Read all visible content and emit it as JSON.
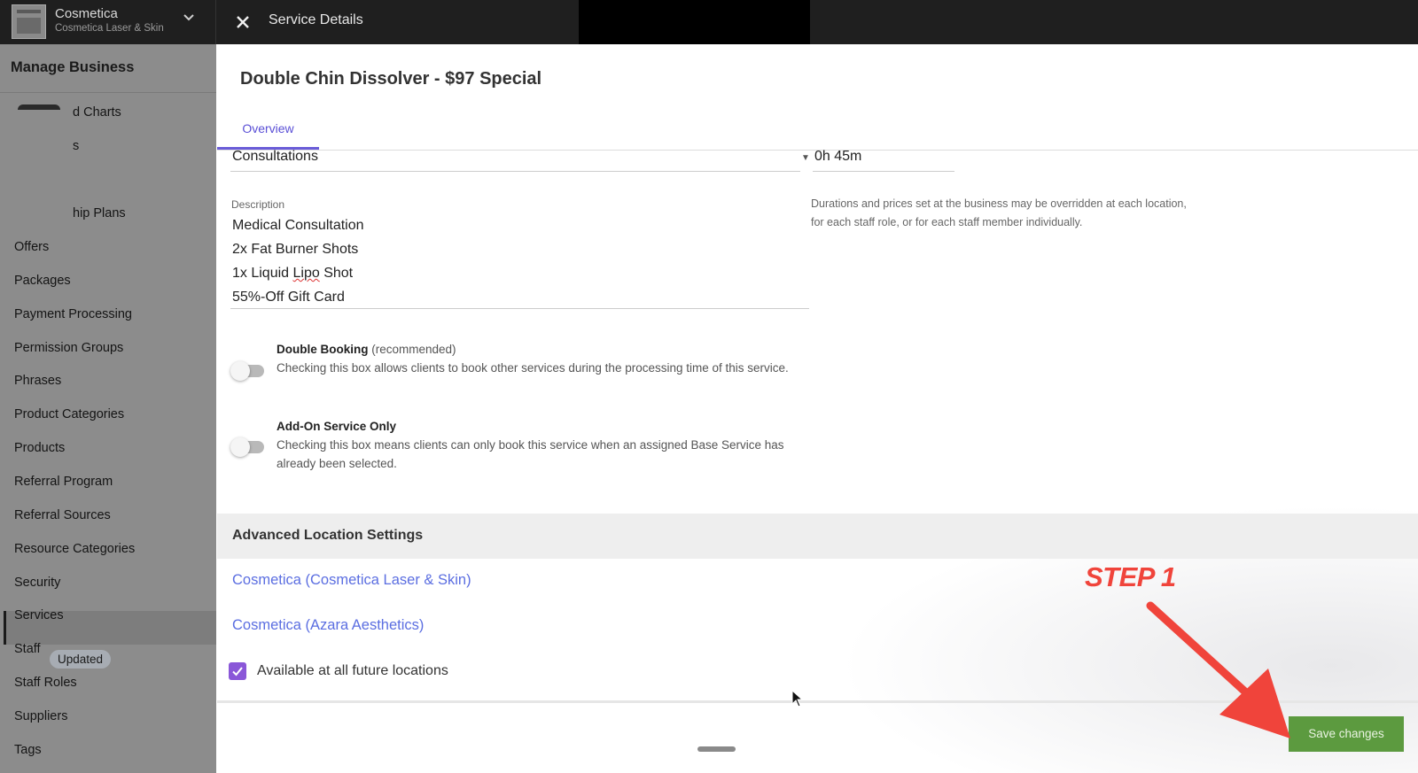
{
  "topbar": {
    "business_name": "Cosmetica",
    "business_sub": "Cosmetica Laser & Skin",
    "panel_title": "Service Details"
  },
  "sidebar": {
    "title": "Manage Business",
    "partial_items": [
      "d Charts",
      "s",
      "hip Plans"
    ],
    "items": [
      "Offers",
      "Packages",
      "Payment Processing",
      "Permission Groups",
      "Phrases",
      "Product Categories",
      "Products",
      "Referral Program",
      "Referral Sources",
      "Resource Categories",
      "Security",
      "Services",
      "Staff",
      "Staff Roles",
      "Suppliers",
      "Tags"
    ],
    "active_item": "Services",
    "staff_badge": "Updated"
  },
  "service": {
    "title": "Double Chin Dissolver - $97 Special",
    "tab_overview": "Overview",
    "category_value": "Consultations",
    "duration_value": "0h 45m",
    "description_label": "Description",
    "description_lines": [
      "Medical Consultation",
      "2x Fat Burner Shots",
      "1x Liquid Lipo Shot",
      "55%-Off Gift Card"
    ],
    "hint": "Durations and prices set at the business may be overridden at each location, for each staff role, or for each staff member individually."
  },
  "options": {
    "double_booking_title": "Double Booking",
    "double_booking_note": "(recommended)",
    "double_booking_desc": "Checking this box allows clients to book other services during the processing time of this service.",
    "double_booking_on": false,
    "addon_title": "Add-On Service Only",
    "addon_desc": "Checking this box means clients can only book this service when an assigned Base Service has already been selected.",
    "addon_on": false
  },
  "advanced": {
    "title": "Advanced Location Settings",
    "locations": [
      "Cosmetica (Cosmetica Laser & Skin)",
      "Cosmetica (Azara Aesthetics)"
    ],
    "future_label": "Available at all future locations",
    "future_checked": true
  },
  "footer": {
    "save_label": "Save changes"
  },
  "annotation": {
    "step_label": "STEP 1",
    "color": "#f0443b"
  },
  "colors": {
    "accent": "#6a5cd8",
    "link": "#5b6ee1",
    "save": "#5c9a3f",
    "checkbox": "#8a57d8"
  }
}
